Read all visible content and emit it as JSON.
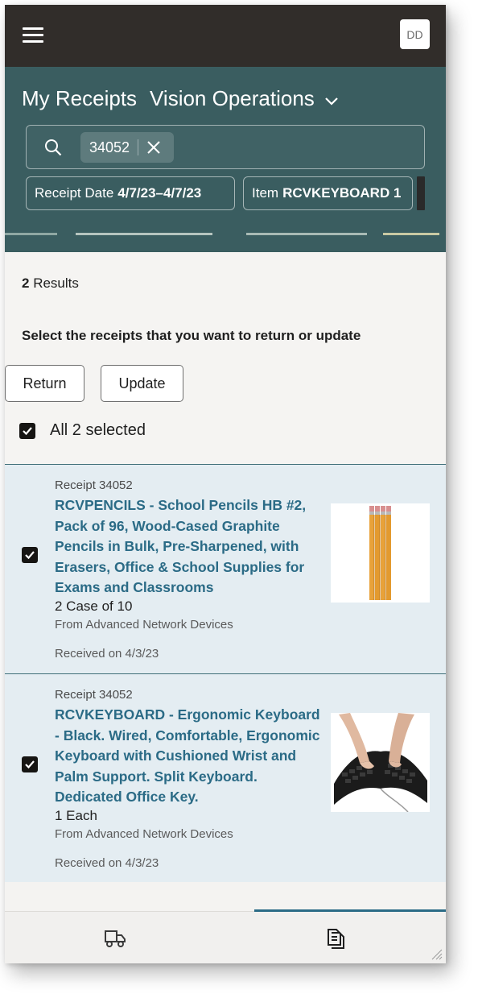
{
  "topbar": {
    "menu_icon": "hamburger-icon",
    "avatar_initials": "DD"
  },
  "header": {
    "title": "My Receipts",
    "org": "Vision Operations",
    "search_chip": "34052",
    "filters": [
      {
        "label": "Receipt Date",
        "value": "4/7/23–4/7/23"
      },
      {
        "label": "Item",
        "value": "RCVKEYBOARD  1"
      }
    ]
  },
  "content": {
    "results_count": "2",
    "results_label": "Results",
    "instruction": "Select the receipts that you want to return or update",
    "return_label": "Return",
    "update_label": "Update",
    "select_all_label": "All 2 selected"
  },
  "receipts": [
    {
      "receipt_number": "Receipt 34052",
      "title": "RCVPENCILS - School Pencils HB #2, Pack of 96, Wood-Cased Graphite Pencils in Bulk, Pre-Sharpened, with Erasers, Office & School Supplies for Exams and Classrooms",
      "quantity": "2 Case of 10",
      "from": "From Advanced Network Devices",
      "received": "Received on 4/3/23",
      "selected": true,
      "image": "pencils-image"
    },
    {
      "receipt_number": "Receipt 34052",
      "title": "RCVKEYBOARD - Ergonomic Keyboard - Black. Wired, Comfortable, Ergonomic Keyboard with Cushioned Wrist and Palm Support. Split Keyboard. Dedicated Office Key.",
      "quantity": "1 Each",
      "from": "From Advanced Network Devices",
      "received": "Received on 4/3/23",
      "selected": true,
      "image": "keyboard-image"
    }
  ],
  "bottom_nav": {
    "active_tab": "receipts",
    "tabs": [
      "truck-icon",
      "document-icon"
    ]
  },
  "colors": {
    "topbar": "#312d2a",
    "header": "#3a5d60",
    "link": "#2b6b86",
    "card_bg": "#e4edf2"
  }
}
